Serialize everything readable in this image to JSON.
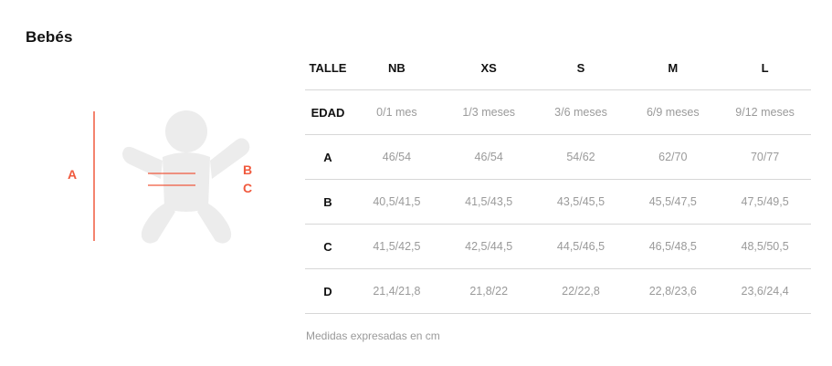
{
  "title": "Bebés",
  "diagram": {
    "label_a": "A",
    "label_b": "B",
    "label_c": "C",
    "accent_color": "#f05a3e",
    "figure_color": "#ececec"
  },
  "table": {
    "columns": [
      "TALLE",
      "NB",
      "XS",
      "S",
      "M",
      "L"
    ],
    "rows": [
      {
        "label": "EDAD",
        "values": [
          "0/1 mes",
          "1/3 meses",
          "3/6 meses",
          "6/9 meses",
          "9/12 meses"
        ]
      },
      {
        "label": "A",
        "values": [
          "46/54",
          "46/54",
          "54/62",
          "62/70",
          "70/77"
        ]
      },
      {
        "label": "B",
        "values": [
          "40,5/41,5",
          "41,5/43,5",
          "43,5/45,5",
          "45,5/47,5",
          "47,5/49,5"
        ]
      },
      {
        "label": "C",
        "values": [
          "41,5/42,5",
          "42,5/44,5",
          "44,5/46,5",
          "46,5/48,5",
          "48,5/50,5"
        ]
      },
      {
        "label": "D",
        "values": [
          "21,4/21,8",
          "21,8/22",
          "22/22,8",
          "22,8/23,6",
          "23,6/24,4"
        ]
      }
    ]
  },
  "note": "Medidas expresadas en cm"
}
